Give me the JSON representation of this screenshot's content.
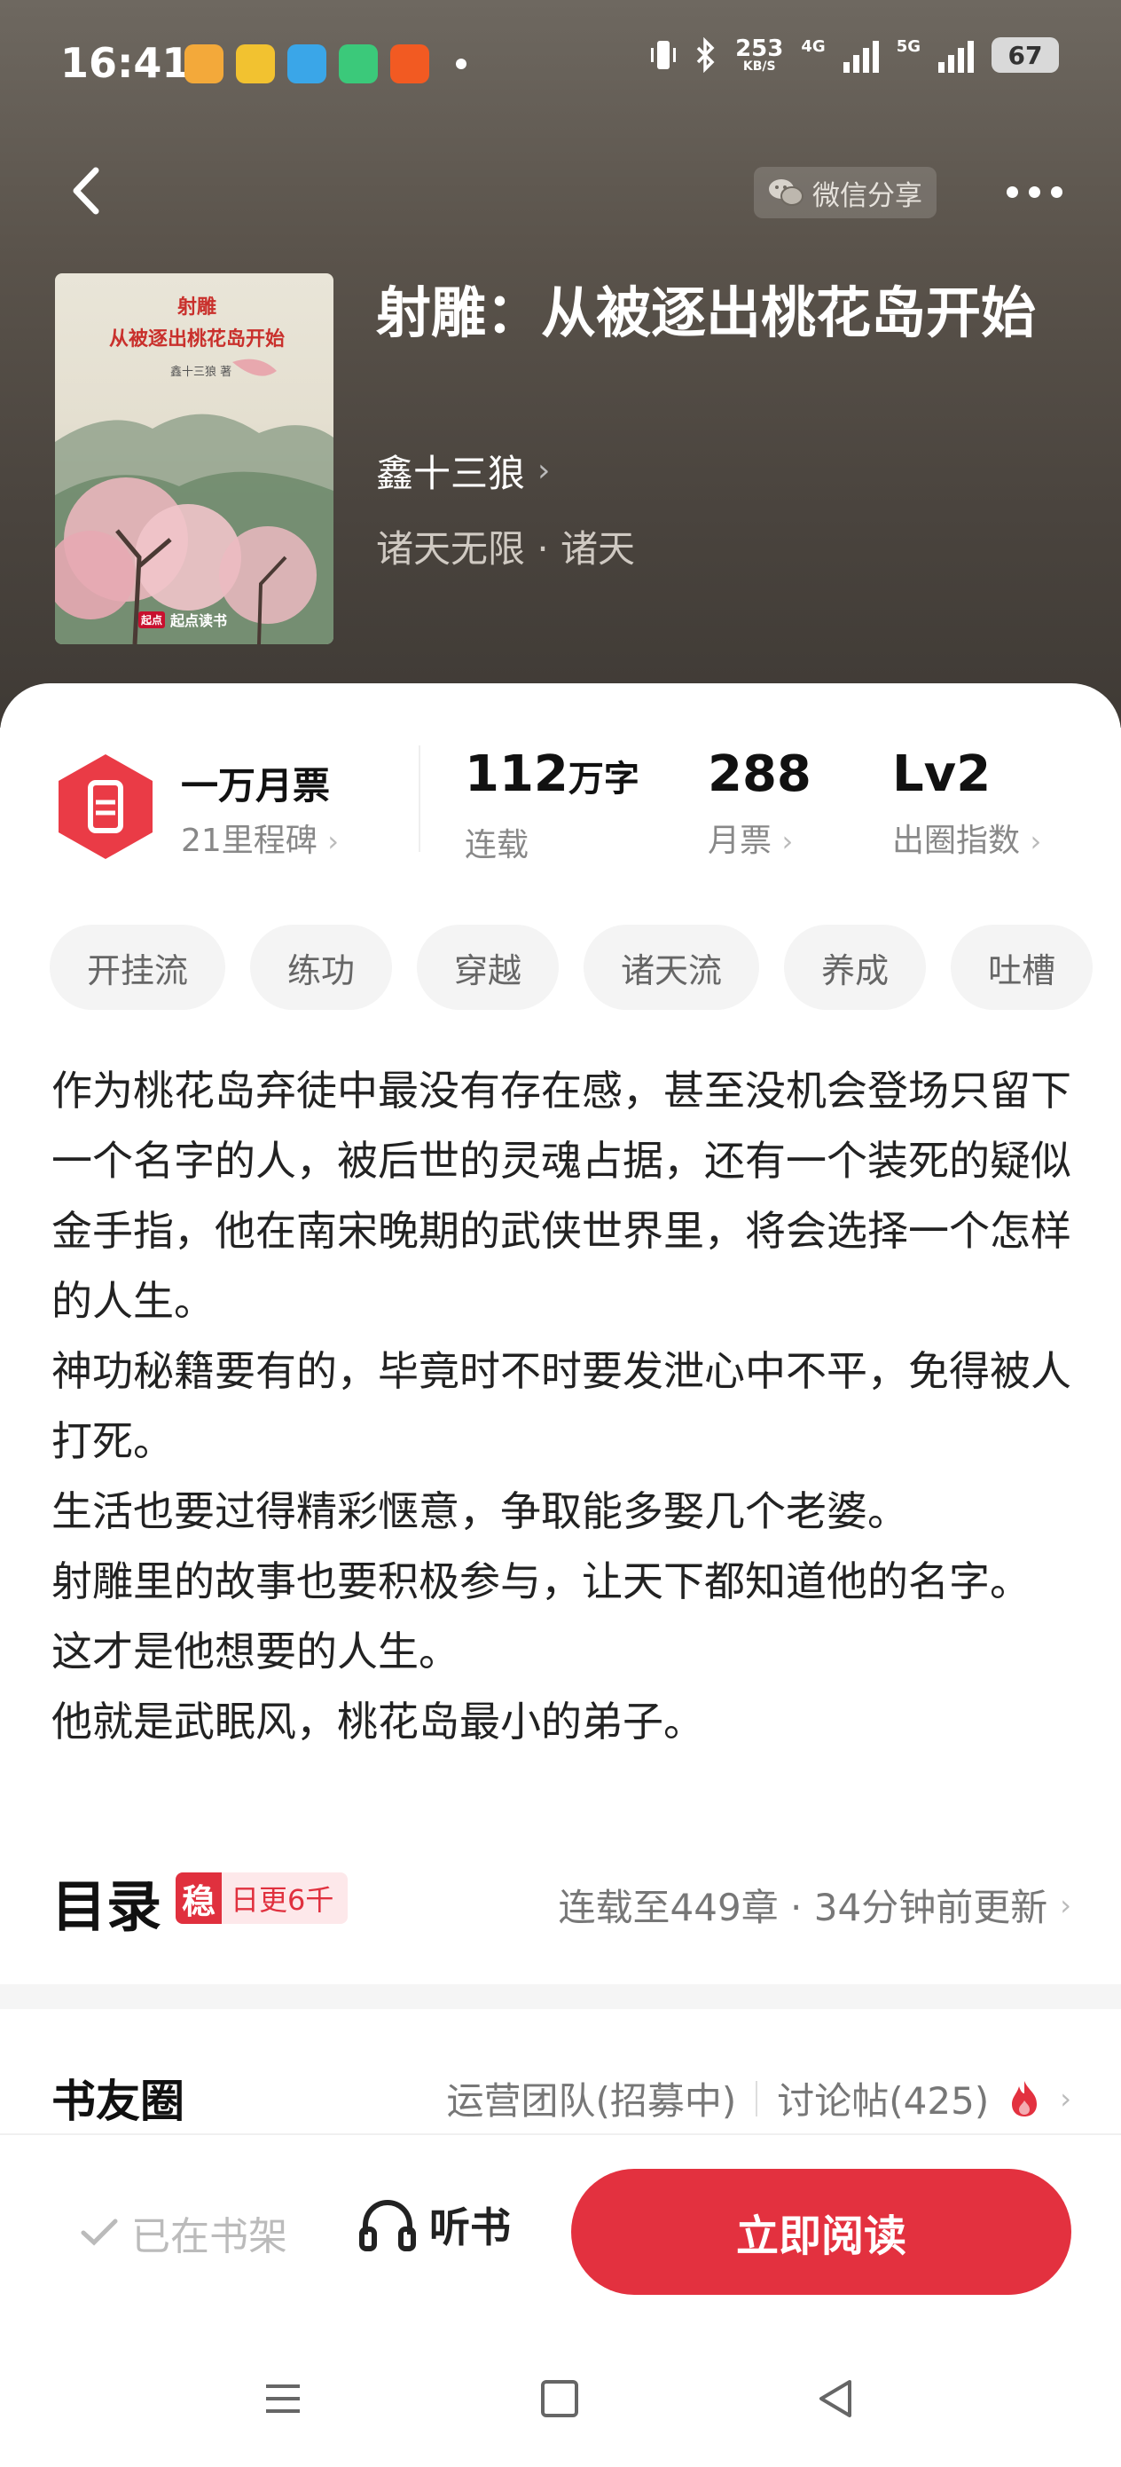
{
  "status_bar": {
    "time": "16:41",
    "net_speed": "253",
    "net_unit": "KB/S",
    "net_type_1": "4G",
    "net_type_2": "5G",
    "battery": "67"
  },
  "header": {
    "wechat_share_label": "微信分享"
  },
  "book": {
    "title": "射雕：从被逐出桃花岛开始",
    "author": "鑫十三狼",
    "genre": "诸天无限 · 诸天",
    "cover": {
      "title_line1": "射雕",
      "title_line2": "从被逐出桃花岛开始",
      "author": "鑫十三狼 著",
      "publisher": "起点读书",
      "publisher_logo": "起点"
    }
  },
  "stats": {
    "ticket_title": "一万月票",
    "ticket_sub": "21里程碑",
    "word_count": "112",
    "word_unit": "万字",
    "word_label": "连载",
    "monthly_votes": "288",
    "monthly_label": "月票",
    "level": "Lv2",
    "level_label": "出圈指数"
  },
  "tags": [
    "开挂流",
    "练功",
    "穿越",
    "诸天流",
    "养成",
    "吐槽"
  ],
  "description": [
    "作为桃花岛弃徒中最没有存在感，甚至没机会登场只留下一个名字的人，被后世的灵魂占据，还有一个装死的疑似金手指，他在南宋晚期的武侠世界里，将会选择一个怎样的人生。",
    "神功秘籍要有的，毕竟时不时要发泄心中不平，免得被人打死。",
    "生活也要过得精彩惬意，争取能多娶几个老婆。",
    "射雕里的故事也要积极参与，让天下都知道他的名字。",
    "这才是他想要的人生。",
    "他就是武眠风，桃花岛最小的弟子。"
  ],
  "toc": {
    "title": "目录",
    "badge_icon": "稳",
    "badge_text": "日更6千",
    "status": "连载至449章 · 34分钟前更新"
  },
  "circle": {
    "title": "书友圈",
    "team": "运营团队(招募中)",
    "threads": "讨论帖(425)"
  },
  "bottom": {
    "shelf_label": "已在书架",
    "listen_label": "听书",
    "read_label": "立即阅读"
  },
  "colors": {
    "accent": "#e3313f",
    "hero_bg": "#5a534b"
  }
}
